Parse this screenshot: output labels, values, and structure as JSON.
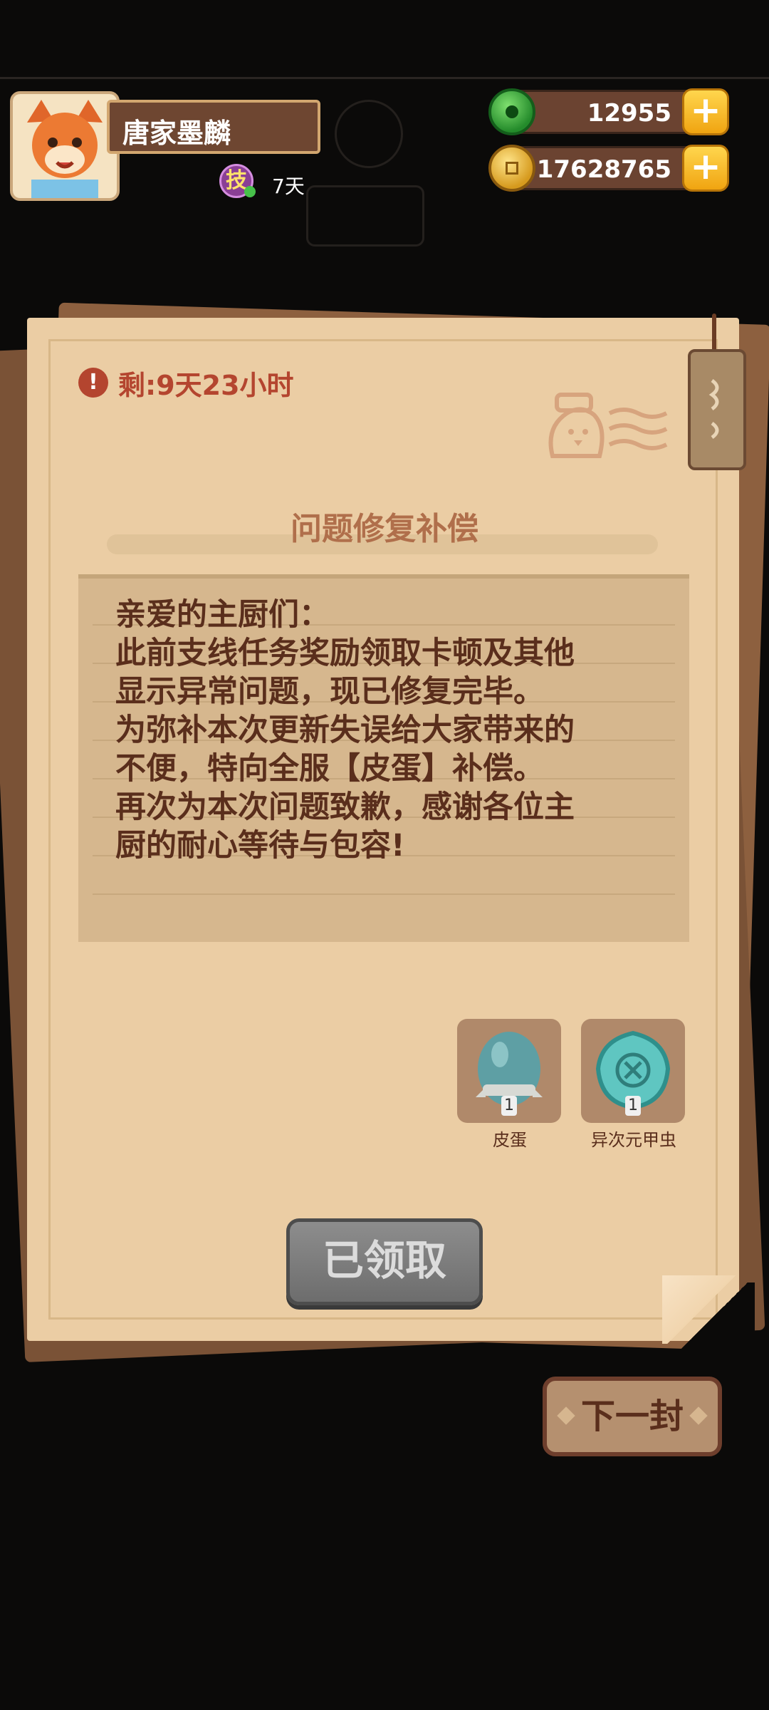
{
  "player": {
    "name": "唐家墨麟",
    "skill_badge": "技",
    "skill_days": "7天"
  },
  "resources": {
    "jade": "12955",
    "coins": "17628765",
    "plus_label": "+"
  },
  "mail": {
    "remaining": "剩:9天23小时",
    "title": "问题修复补偿",
    "body_lines": [
      "亲爱的主厨们：",
      "此前支线任务奖励领取卡顿及其他",
      "显示异常问题，现已修复完毕。",
      "为弥补本次更新失误给大家带来的",
      "不便，特向全服【皮蛋】补偿。",
      "再次为本次问题致歉，感谢各位主",
      "厨的耐心等待与包容!"
    ],
    "rewards": [
      {
        "name": "皮蛋",
        "qty": "1",
        "icon": "egg-icon"
      },
      {
        "name": "异次元甲虫",
        "qty": "1",
        "icon": "beetle-icon"
      }
    ],
    "claimed_label": "已领取",
    "next_label": "下一封"
  },
  "colors": {
    "paper": "#ebcda4",
    "accent_red": "#b4452f",
    "text_brown": "#5a2e1c",
    "title_brown": "#b06f4b"
  }
}
